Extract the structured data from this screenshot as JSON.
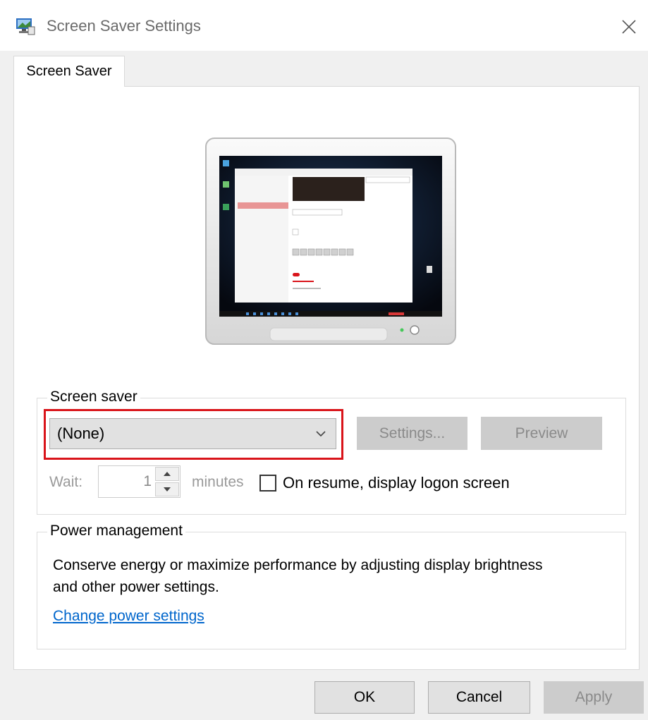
{
  "window": {
    "title": "Screen Saver Settings"
  },
  "tabs": [
    {
      "label": "Screen Saver"
    }
  ],
  "screen_saver": {
    "group_label": "Screen saver",
    "selected": "(None)",
    "settings_label": "Settings...",
    "preview_label": "Preview",
    "wait_label": "Wait:",
    "wait_value": "1",
    "minutes_label": "minutes",
    "logon_label": "On resume, display logon screen"
  },
  "power": {
    "group_label": "Power management",
    "description": "Conserve energy or maximize performance by adjusting display brightness and other power settings.",
    "link": "Change power settings"
  },
  "buttons": {
    "ok": "OK",
    "cancel": "Cancel",
    "apply": "Apply"
  },
  "colors": {
    "highlight": "#d9141a",
    "link": "#0066cc"
  }
}
